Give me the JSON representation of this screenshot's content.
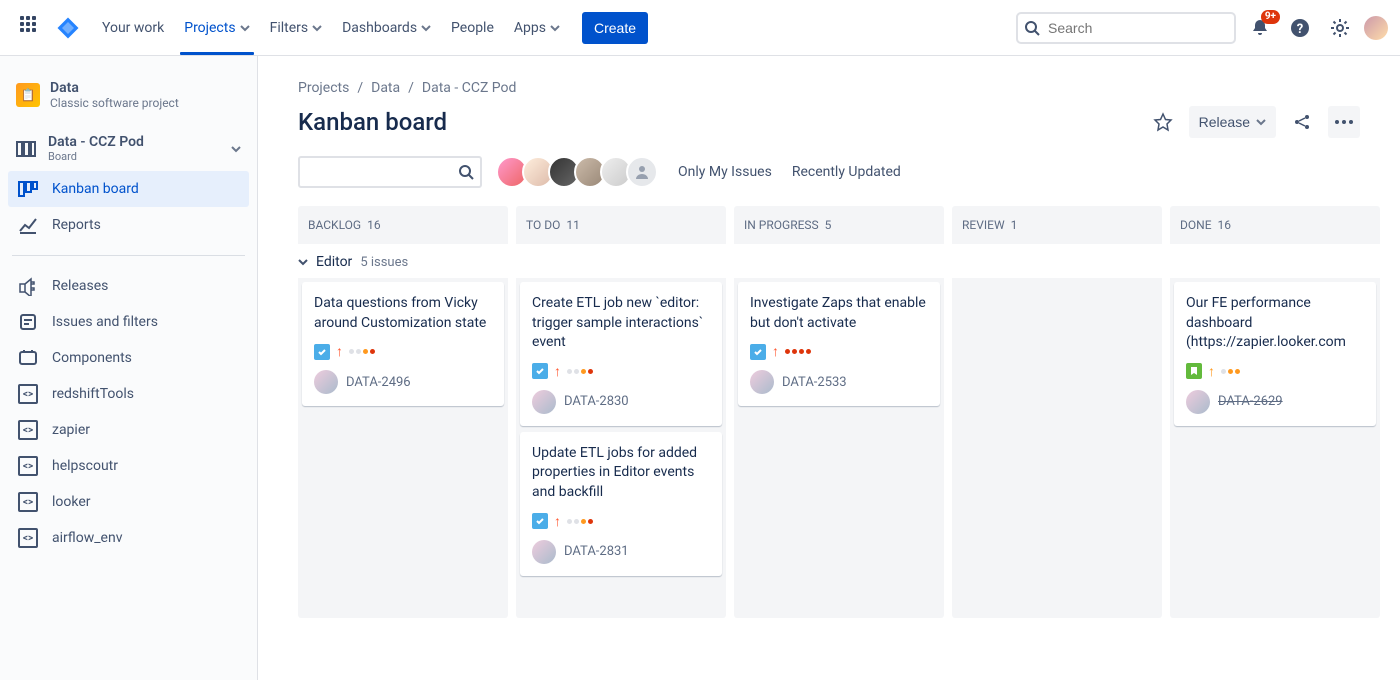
{
  "topnav": {
    "yourWork": "Your work",
    "projects": "Projects",
    "filters": "Filters",
    "dashboards": "Dashboards",
    "people": "People",
    "apps": "Apps",
    "create": "Create",
    "searchPlaceholder": "Search",
    "notifBadge": "9+"
  },
  "sidebar": {
    "projectName": "Data",
    "projectSub": "Classic software project",
    "boardName": "Data - CCZ Pod",
    "boardSub": "Board",
    "kanban": "Kanban board",
    "reports": "Reports",
    "releases": "Releases",
    "issues": "Issues and filters",
    "components": "Components",
    "redshiftTools": "redshiftTools",
    "zapier": "zapier",
    "helpscoutr": "helpscoutr",
    "looker": "looker",
    "airflow": "airflow_env"
  },
  "crumbs": {
    "a": "Projects",
    "b": "Data",
    "c": "Data - CCZ Pod"
  },
  "title": "Kanban board",
  "release": "Release",
  "quickFilters": {
    "mine": "Only My Issues",
    "recent": "Recently Updated"
  },
  "columns": [
    {
      "name": "BACKLOG",
      "count": "16"
    },
    {
      "name": "TO DO",
      "count": "11"
    },
    {
      "name": "IN PROGRESS",
      "count": "5"
    },
    {
      "name": "REVIEW",
      "count": "1"
    },
    {
      "name": "DONE",
      "count": "16"
    }
  ],
  "swimlane": {
    "name": "Editor",
    "count": "5 issues"
  },
  "cards": {
    "backlog": [
      {
        "title": "Data questions from Vicky around Customization state",
        "key": "DATA-2496",
        "type": "task",
        "dots": [
          "g",
          "g",
          "o",
          "r"
        ]
      }
    ],
    "todo": [
      {
        "title": "Create ETL job new `editor: trigger sample interactions` event",
        "key": "DATA-2830",
        "type": "task",
        "dots": [
          "g",
          "g",
          "o",
          "r"
        ]
      },
      {
        "title": "Update ETL jobs for added properties in Editor events and backfill",
        "key": "DATA-2831",
        "type": "task",
        "dots": [
          "g",
          "g",
          "o",
          "r"
        ]
      }
    ],
    "inprogress": [
      {
        "title": "Investigate Zaps that enable but don't activate",
        "key": "DATA-2533",
        "type": "task",
        "dots": [
          "r",
          "r",
          "r",
          "r"
        ]
      }
    ],
    "done": [
      {
        "title": "Our FE performance dashboard (https://zapier.looker.com",
        "key": "DATA-2629",
        "type": "story",
        "dots": [
          "g",
          "o",
          "o"
        ],
        "done": true
      }
    ]
  }
}
